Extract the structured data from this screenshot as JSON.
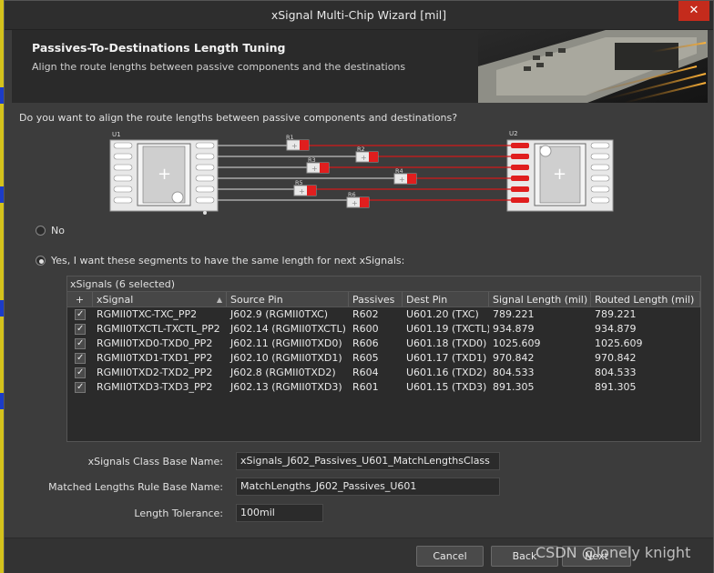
{
  "window": {
    "title": "xSignal Multi-Chip Wizard [mil]",
    "close_glyph": "✕"
  },
  "header": {
    "title": "Passives-To-Destinations Length Tuning",
    "subtitle": "Align the route lengths between passive components and the destinations"
  },
  "question": "Do you want to align the route lengths between passive components and destinations?",
  "diagram": {
    "u1_label": "U1",
    "u2_label": "U2",
    "resistors": [
      "R1",
      "R2",
      "R3",
      "R4",
      "R5",
      "R6"
    ],
    "colors": {
      "trace_gray": "#bfbfbf",
      "trace_red": "#d11a1a",
      "pad_red": "#e01e1e",
      "body": "#d8d8d8"
    }
  },
  "options": {
    "no_label": "No",
    "yes_label": "Yes, I want these segments to have the same length for next xSignals:",
    "selected": "yes"
  },
  "grid": {
    "caption": "xSignals (6 selected)",
    "add_glyph": "+",
    "columns": [
      "xSignal",
      "Source Pin",
      "Passives",
      "Dest Pin",
      "Signal Length (mil)",
      "Routed Length (mil)"
    ],
    "rows": [
      {
        "checked": true,
        "xsignal": "RGMII0TXC-TXC_PP2",
        "source": "J602.9 (RGMII0TXC)",
        "passive": "R602",
        "dest": "U601.20 (TXC)",
        "signal_len": "789.221",
        "routed_len": "789.221"
      },
      {
        "checked": true,
        "xsignal": "RGMII0TXCTL-TXCTL_PP2",
        "source": "J602.14 (RGMII0TXCTL)",
        "passive": "R600",
        "dest": "U601.19 (TXCTL)",
        "signal_len": "934.879",
        "routed_len": "934.879"
      },
      {
        "checked": true,
        "xsignal": "RGMII0TXD0-TXD0_PP2",
        "source": "J602.11 (RGMII0TXD0)",
        "passive": "R606",
        "dest": "U601.18 (TXD0)",
        "signal_len": "1025.609",
        "routed_len": "1025.609"
      },
      {
        "checked": true,
        "xsignal": "RGMII0TXD1-TXD1_PP2",
        "source": "J602.10 (RGMII0TXD1)",
        "passive": "R605",
        "dest": "U601.17 (TXD1)",
        "signal_len": "970.842",
        "routed_len": "970.842"
      },
      {
        "checked": true,
        "xsignal": "RGMII0TXD2-TXD2_PP2",
        "source": "J602.8 (RGMII0TXD2)",
        "passive": "R604",
        "dest": "U601.16 (TXD2)",
        "signal_len": "804.533",
        "routed_len": "804.533"
      },
      {
        "checked": true,
        "xsignal": "RGMII0TXD3-TXD3_PP2",
        "source": "J602.13 (RGMII0TXD3)",
        "passive": "R601",
        "dest": "U601.15 (TXD3)",
        "signal_len": "891.305",
        "routed_len": "891.305"
      }
    ]
  },
  "fields": {
    "class_label": "xSignals Class Base Name:",
    "class_value": "xSignals_J602_Passives_U601_MatchLengthsClass",
    "rule_label": "Matched Lengths Rule Base Name:",
    "rule_value": "MatchLengths_J602_Passives_U601",
    "tolerance_label": "Length Tolerance:",
    "tolerance_value": "100mil"
  },
  "buttons": {
    "cancel": "Cancel",
    "back": "Back",
    "next": "Next"
  },
  "watermark": "CSDN @lonely knight"
}
